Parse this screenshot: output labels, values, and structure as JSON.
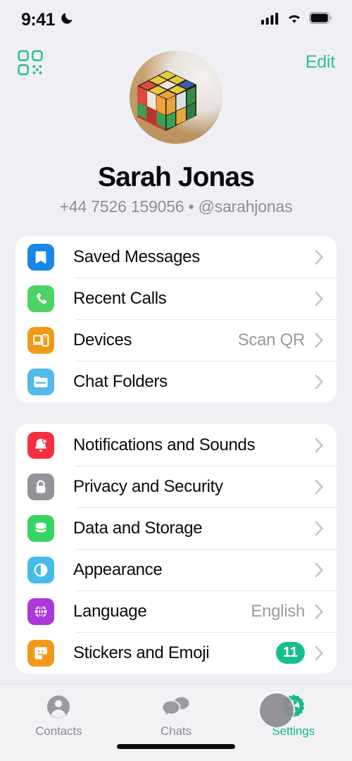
{
  "status_bar": {
    "time": "9:41",
    "moon_icon": "crescent-moon-icon",
    "signal_icon": "cellular-signal-icon",
    "wifi_icon": "wifi-icon",
    "battery_icon": "battery-full-icon"
  },
  "header": {
    "qr_icon": "qr-code-icon",
    "edit_label": "Edit",
    "avatar_icon": "rubiks-cube-avatar"
  },
  "profile": {
    "name": "Sarah Jonas",
    "subtitle": "+44 7526 159056 • @sarahjonas",
    "phone": "+44 7526 159056",
    "username": "@sarahjonas"
  },
  "colors": {
    "accent": "#2fbf93",
    "badge": "#14c08e",
    "page_bg": "#f0f0f4",
    "card_bg": "#ffffff",
    "secondary_text": "#8e8e94"
  },
  "groups": [
    {
      "id": "group1",
      "rows": [
        {
          "label": "Saved Messages",
          "value": "",
          "badge": "",
          "icon": "bookmark-icon",
          "icon_color": "#1787e8"
        },
        {
          "label": "Recent Calls",
          "value": "",
          "badge": "",
          "icon": "phone-icon",
          "icon_color": "#4bd464"
        },
        {
          "label": "Devices",
          "value": "Scan QR",
          "badge": "",
          "icon": "devices-icon",
          "icon_color": "#f09a1a"
        },
        {
          "label": "Chat Folders",
          "value": "",
          "badge": "",
          "icon": "folder-icon",
          "icon_color": "#52b9e8"
        }
      ]
    },
    {
      "id": "group2",
      "rows": [
        {
          "label": "Notifications and Sounds",
          "value": "",
          "badge": "",
          "icon": "bell-icon",
          "icon_color": "#f72f3e"
        },
        {
          "label": "Privacy and Security",
          "value": "",
          "badge": "",
          "icon": "lock-icon",
          "icon_color": "#939399"
        },
        {
          "label": "Data and Storage",
          "value": "",
          "badge": "",
          "icon": "database-icon",
          "icon_color": "#37d463"
        },
        {
          "label": "Appearance",
          "value": "",
          "badge": "",
          "icon": "contrast-icon",
          "icon_color": "#47bbe8"
        },
        {
          "label": "Language",
          "value": "English",
          "badge": "",
          "icon": "globe-icon",
          "icon_color": "#ad37da"
        },
        {
          "label": "Stickers and Emoji",
          "value": "",
          "badge": "11",
          "icon": "sticker-icon",
          "icon_color": "#f09a1a"
        }
      ]
    }
  ],
  "tabs": [
    {
      "label": "Contacts",
      "icon": "person-circle-icon",
      "active": false
    },
    {
      "label": "Chats",
      "icon": "chat-bubbles-icon",
      "active": false
    },
    {
      "label": "Settings",
      "icon": "gear-icon",
      "active": true
    }
  ]
}
